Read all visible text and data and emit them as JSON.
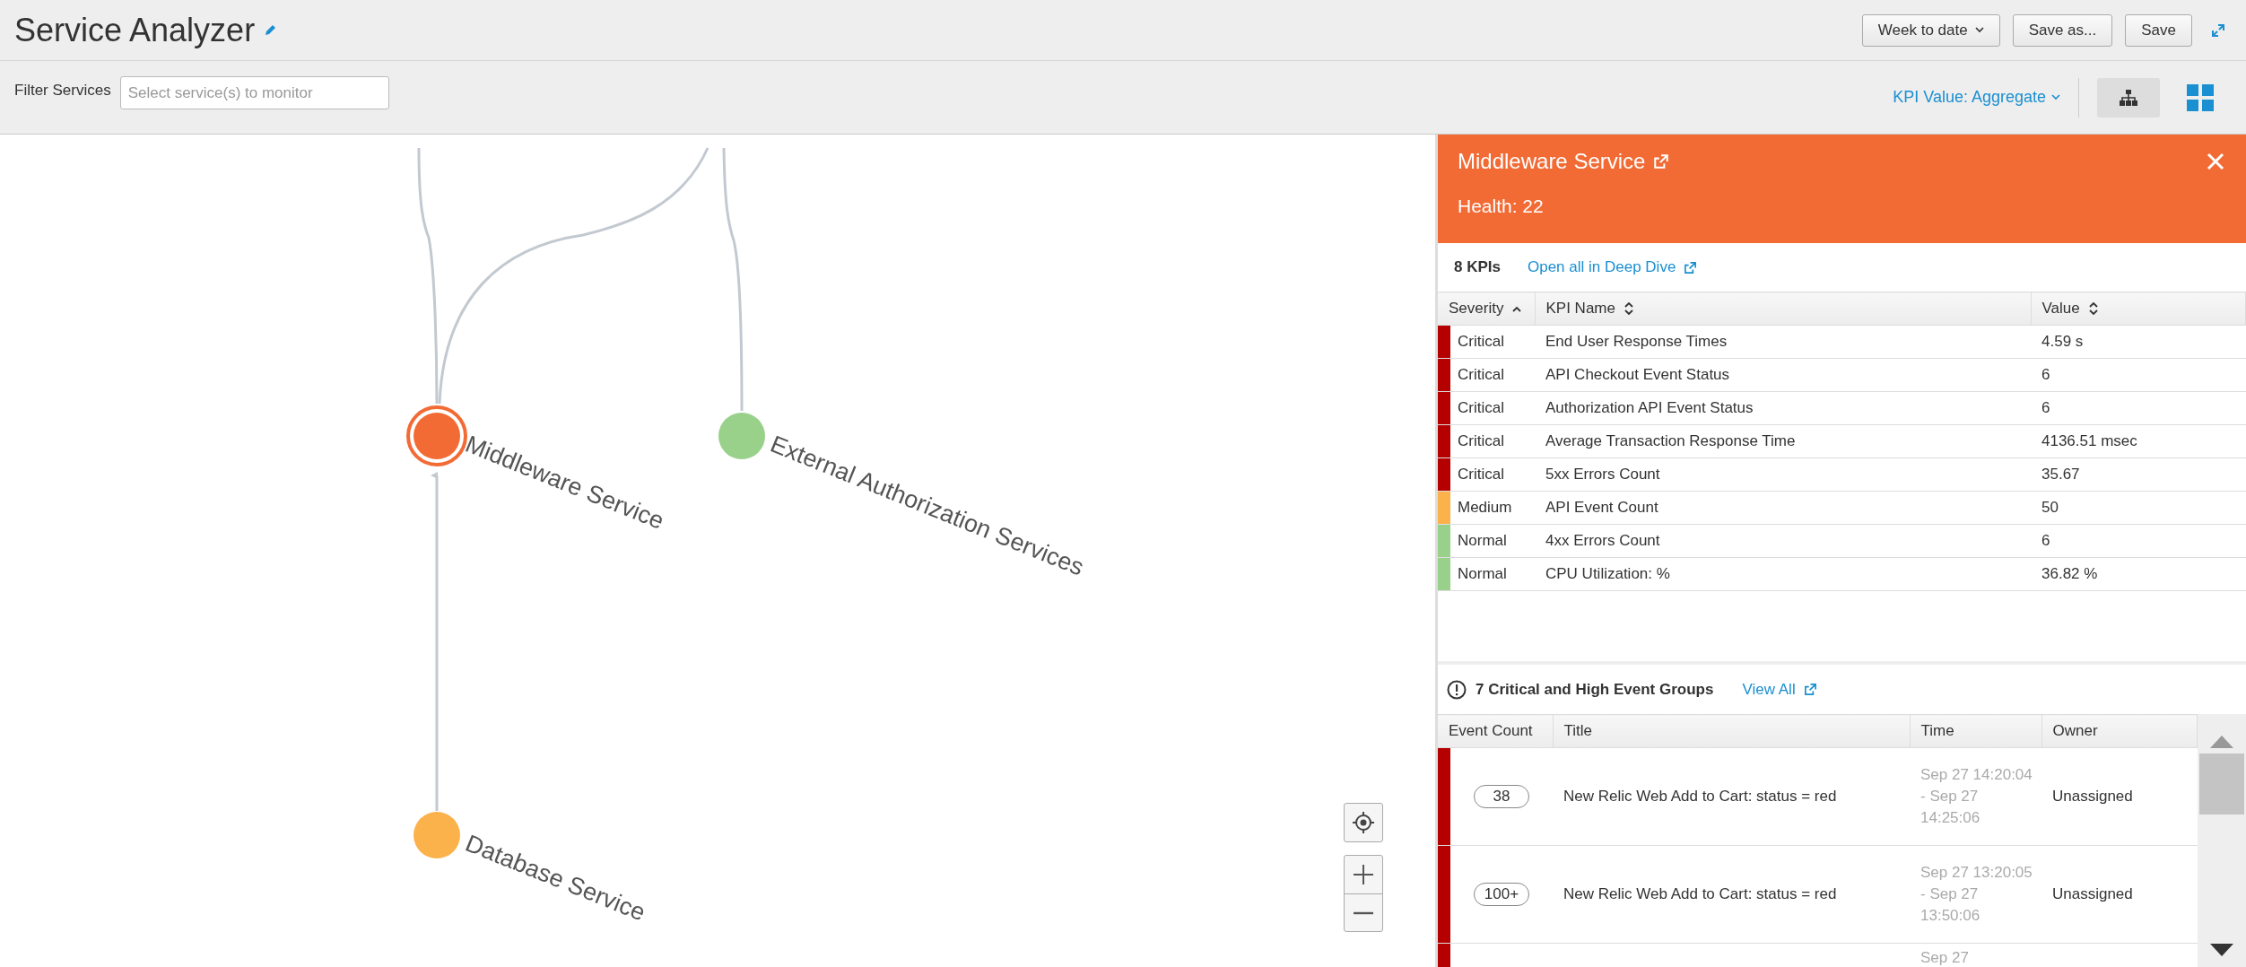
{
  "header": {
    "title": "Service Analyzer",
    "buttons": [
      {
        "label": "Week to date",
        "kind": "dropdown"
      },
      {
        "label": "Save as...",
        "kind": "plain"
      },
      {
        "label": "Save",
        "kind": "plain"
      }
    ]
  },
  "filter": {
    "label": "Filter Services",
    "placeholder": "Select service(s) to monitor"
  },
  "toolbar": {
    "kpi_dropdown": "KPI Value: Aggregate",
    "views": [
      {
        "kind": "tree",
        "selected": true
      },
      {
        "kind": "tiles",
        "selected": false
      }
    ]
  },
  "graph": {
    "nodes": [
      {
        "label": "Middleware Service",
        "color": "#f26b35",
        "selected": true
      },
      {
        "label": "External Authorization Services",
        "color": "#99d18b",
        "selected": false
      },
      {
        "label": "Database Service",
        "color": "#fcb24b",
        "selected": false
      }
    ]
  },
  "panel": {
    "title": "Middleware Service",
    "health": "Health: 22",
    "kpi_count": "8 KPIs",
    "deep_dive_link": "Open all in Deep Dive",
    "kpi_columns": [
      {
        "label": "Severity",
        "sorted": true
      },
      {
        "label": "KPI Name",
        "sorted": false
      },
      {
        "label": "Value",
        "sorted": false
      }
    ],
    "kpi_rows": [
      {
        "severity": "Critical",
        "color": "#b50000",
        "name": "End User Response Times",
        "value": "4.59 s"
      },
      {
        "severity": "Critical",
        "color": "#b50000",
        "name": "API Checkout Event Status",
        "value": "6"
      },
      {
        "severity": "Critical",
        "color": "#b50000",
        "name": "Authorization API Event Status",
        "value": "6"
      },
      {
        "severity": "Critical",
        "color": "#b50000",
        "name": "Average Transaction Response Time",
        "value": "4136.51 msec"
      },
      {
        "severity": "Critical",
        "color": "#b50000",
        "name": "5xx Errors Count",
        "value": "35.67"
      },
      {
        "severity": "Medium",
        "color": "#fcb24b",
        "name": "API Event Count",
        "value": "50"
      },
      {
        "severity": "Normal",
        "color": "#99d18b",
        "name": "4xx Errors Count",
        "value": "6"
      },
      {
        "severity": "Normal",
        "color": "#99d18b",
        "name": "CPU Utilization: %",
        "value": "36.82 %"
      }
    ],
    "events_heading": "7 Critical and High Event Groups",
    "view_all_link": "View All",
    "event_columns": [
      "Event Count",
      "Title",
      "Time",
      "Owner"
    ],
    "event_rows": [
      {
        "color": "#b50000",
        "count": "38",
        "title": "New Relic Web Add to Cart: status = red",
        "time": "Sep 27 14:20:04 - Sep 27 14:25:06",
        "owner": "Unassigned"
      },
      {
        "color": "#b50000",
        "count": "100+",
        "title": "New Relic Web Add to Cart: status = red",
        "time": "Sep 27 13:20:05 - Sep 27 13:50:06",
        "owner": "Unassigned"
      },
      {
        "color": "#b50000",
        "time": "Sep 27"
      }
    ]
  }
}
